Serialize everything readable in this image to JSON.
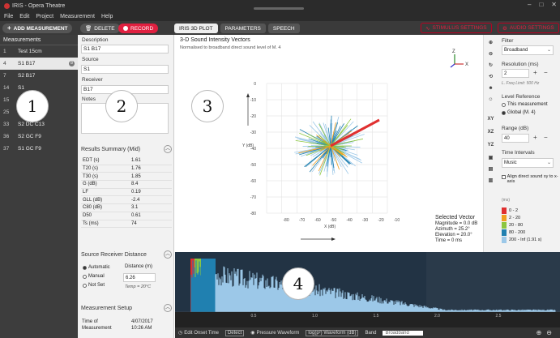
{
  "window": {
    "title": "IRIS - Opera Theatre"
  },
  "menu": [
    "File",
    "Edit",
    "Project",
    "Measurement",
    "Help"
  ],
  "toolbar": {
    "add_measurement": "ADD MEASUREMENT",
    "delete": "DELETE",
    "record": "RECORD",
    "tabs": [
      "IRIS 3D PLOT",
      "PARAMETERS",
      "SPEECH"
    ],
    "active_tab": "IRIS 3D PLOT",
    "stimulus_settings": "STIMULUS SETTINGS",
    "audio_settings": "AUDIO SETTINGS"
  },
  "measurements": {
    "header": "Measurements",
    "items": [
      {
        "num": "1",
        "name": "Test 15cm"
      },
      {
        "num": "4",
        "name": "S1 B17",
        "badge": "8"
      },
      {
        "num": "7",
        "name": "S2 B17"
      },
      {
        "num": "14",
        "name": "S1"
      },
      {
        "num": "15",
        "name": "S1"
      },
      {
        "num": "25",
        "name": "S2"
      },
      {
        "num": "33",
        "name": "S2 DC C13"
      },
      {
        "num": "36",
        "name": "S2 GC F9"
      },
      {
        "num": "37",
        "name": "S1 GC F9"
      }
    ]
  },
  "details": {
    "description_label": "Description",
    "description_value": "S1 B17",
    "source_label": "Source",
    "source_value": "S1",
    "receiver_label": "Receiver",
    "receiver_value": "B17",
    "notes_label": "Notes",
    "results_title": "Results Summary (Mid)",
    "results": [
      {
        "name": "EDT (s)",
        "value": "1.61"
      },
      {
        "name": "T20 (s)",
        "value": "1.76"
      },
      {
        "name": "T30 (s)",
        "value": "1.85"
      },
      {
        "name": "G (dB)",
        "value": "8.4"
      },
      {
        "name": "LF",
        "value": "0.19"
      },
      {
        "name": "GLL (dB)",
        "value": "-2.4"
      },
      {
        "name": "C80 (dB)",
        "value": "3.1"
      },
      {
        "name": "D50",
        "value": "0.61"
      },
      {
        "name": "Ts (ms)",
        "value": "74"
      }
    ],
    "srd_title": "Source Receiver Distance",
    "srd_options": [
      "Automatic",
      "Manual",
      "Not Set"
    ],
    "distance_label": "Distance (m)",
    "distance_value": "6.26",
    "temp": "Temp = 20°C",
    "setup_title": "Measurement Setup",
    "time_label": "Time of",
    "measurement_label": "Measurement",
    "date": "4/07/2017",
    "time": "10:26 AM"
  },
  "plot": {
    "title": "3-D Sound Intensity Vectors",
    "subtitle": "Normalised to broadband direct sound level of M. 4",
    "y_label": "Y (dB)",
    "x_label": "X (dB)",
    "y_ticks": [
      "0",
      "-10",
      "-20",
      "-30",
      "-40",
      "-50",
      "-60",
      "-70",
      "-80"
    ],
    "x_ticks": [
      "-80",
      "-70",
      "-60",
      "-50",
      "-40",
      "-30",
      "-20",
      "-10"
    ],
    "axis_z": "Z",
    "axis_x": "X",
    "selected_vector": {
      "title": "Selected Vector",
      "magnitude": "Magnitude = 0.0 dB",
      "azimuth": "Azimuth = 25.2°",
      "elevation": "Elevation = 20.0°",
      "time": "Time = 0 ms"
    }
  },
  "vtools": [
    "XY",
    "XZ",
    "YZ"
  ],
  "settings": {
    "filter_label": "Filter",
    "filter_value": "Broadband",
    "resolution_label": "Resolution (ms)",
    "resolution_value": "2",
    "freq_limit": "L. Freq Limit: 500 Hz",
    "level_ref_label": "Level Reference",
    "level_ref_options": [
      "This measurement",
      "Global (M. 4)"
    ],
    "range_label": "Range (dB)",
    "range_value": "40",
    "time_intervals_label": "Time Intervals",
    "time_intervals_value": "Music",
    "align_label": "Align direct sound xy to x-axis",
    "legend_unit": "(ms)",
    "legend": [
      {
        "label": "0 - 2",
        "color": "#e03030"
      },
      {
        "label": "2 - 20",
        "color": "#f0a020"
      },
      {
        "label": "20 - 80",
        "color": "#8cc640"
      },
      {
        "label": "80 - 200",
        "color": "#2080b0"
      },
      {
        "label": "200 - Inf (1.91 s)",
        "color": "#9cc8e8"
      }
    ]
  },
  "waveform": {
    "x_ticks": [
      "0.5",
      "1.0",
      "1.5",
      "2.0",
      "2.5"
    ],
    "edit_onset": "Edit Onset Time",
    "detect": "Detect",
    "pressure": "Pressure Waveform",
    "log_label": "log(p²) Waveform (dB)",
    "band_label": "Band",
    "band_value": "Broadband"
  },
  "markers": [
    "1",
    "2",
    "3",
    "4"
  ]
}
